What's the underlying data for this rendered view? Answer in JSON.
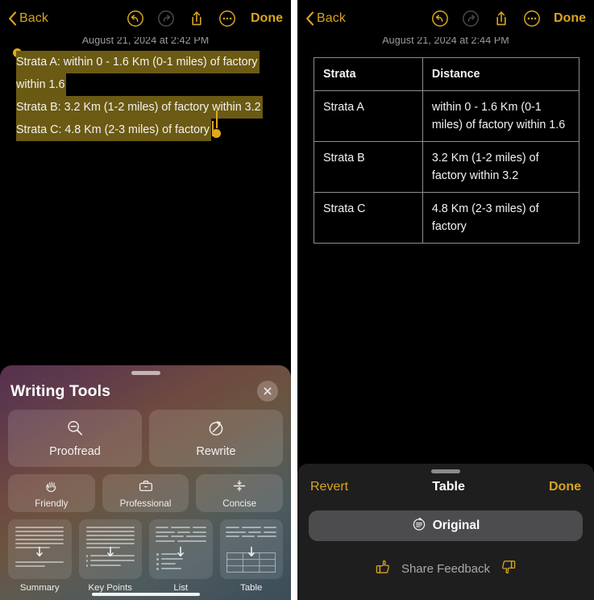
{
  "divider_color": "#ffffff",
  "accent_gold": "#d9a520",
  "selection_highlight": "#6b5a13",
  "selection_handle": "#e2a91a",
  "left_phone": {
    "navbar": {
      "back_label": "Back",
      "back_icon": "chevron-left-icon",
      "undo_icon": "undo-icon",
      "undo_enabled": true,
      "redo_icon": "redo-icon",
      "redo_enabled": false,
      "share_icon": "share-icon",
      "more_icon": "ellipsis-circle-icon",
      "done_label": "Done"
    },
    "timestamp": "August 21, 2024 at 2:42 PM",
    "note_lines": [
      "Strata A: within 0 - 1.6 Km (0-1 miles) of factory",
      "within 1.6",
      "Strata B: 3.2 Km (1-2 miles) of factory within 3.2",
      "Strata C: 4.8 Km (2-3 miles) of factory"
    ],
    "writing_tools": {
      "title": "Writing Tools",
      "close_icon": "close-icon",
      "primary": [
        {
          "label": "Proofread",
          "icon": "magnifier-minus-icon"
        },
        {
          "label": "Rewrite",
          "icon": "pencil-circle-icon"
        }
      ],
      "tones": [
        {
          "label": "Friendly",
          "icon": "waving-hand-icon"
        },
        {
          "label": "Professional",
          "icon": "briefcase-icon"
        },
        {
          "label": "Concise",
          "icon": "compress-arrows-icon"
        }
      ],
      "transforms": [
        {
          "label": "Summary",
          "icon": "summary-thumbnail-icon"
        },
        {
          "label": "Key Points",
          "icon": "key-points-thumbnail-icon"
        },
        {
          "label": "List",
          "icon": "list-thumbnail-icon"
        },
        {
          "label": "Table",
          "icon": "table-thumbnail-icon"
        }
      ]
    }
  },
  "right_phone": {
    "navbar": {
      "back_label": "Back",
      "back_icon": "chevron-left-icon",
      "undo_icon": "undo-icon",
      "undo_enabled": true,
      "redo_icon": "redo-icon",
      "redo_enabled": false,
      "share_icon": "share-icon",
      "more_icon": "ellipsis-circle-icon",
      "done_label": "Done"
    },
    "timestamp": "August 21, 2024 at 2:44 PM",
    "table": {
      "headers": [
        "Strata",
        "Distance"
      ],
      "rows": [
        [
          "Strata A",
          "within 0 - 1.6 Km (0-1 miles) of factory within 1.6"
        ],
        [
          "Strata B",
          "3.2 Km (1-2 miles) of factory within 3.2"
        ],
        [
          "Strata C",
          "4.8 Km (2-3 miles) of factory"
        ]
      ]
    },
    "bottom_sheet": {
      "revert_label": "Revert",
      "title": "Table",
      "done_label": "Done",
      "original_label": "Original",
      "original_icon": "revert-text-icon",
      "feedback_label": "Share Feedback",
      "thumbs_up_icon": "thumbs-up-icon",
      "thumbs_down_icon": "thumbs-down-icon"
    }
  }
}
